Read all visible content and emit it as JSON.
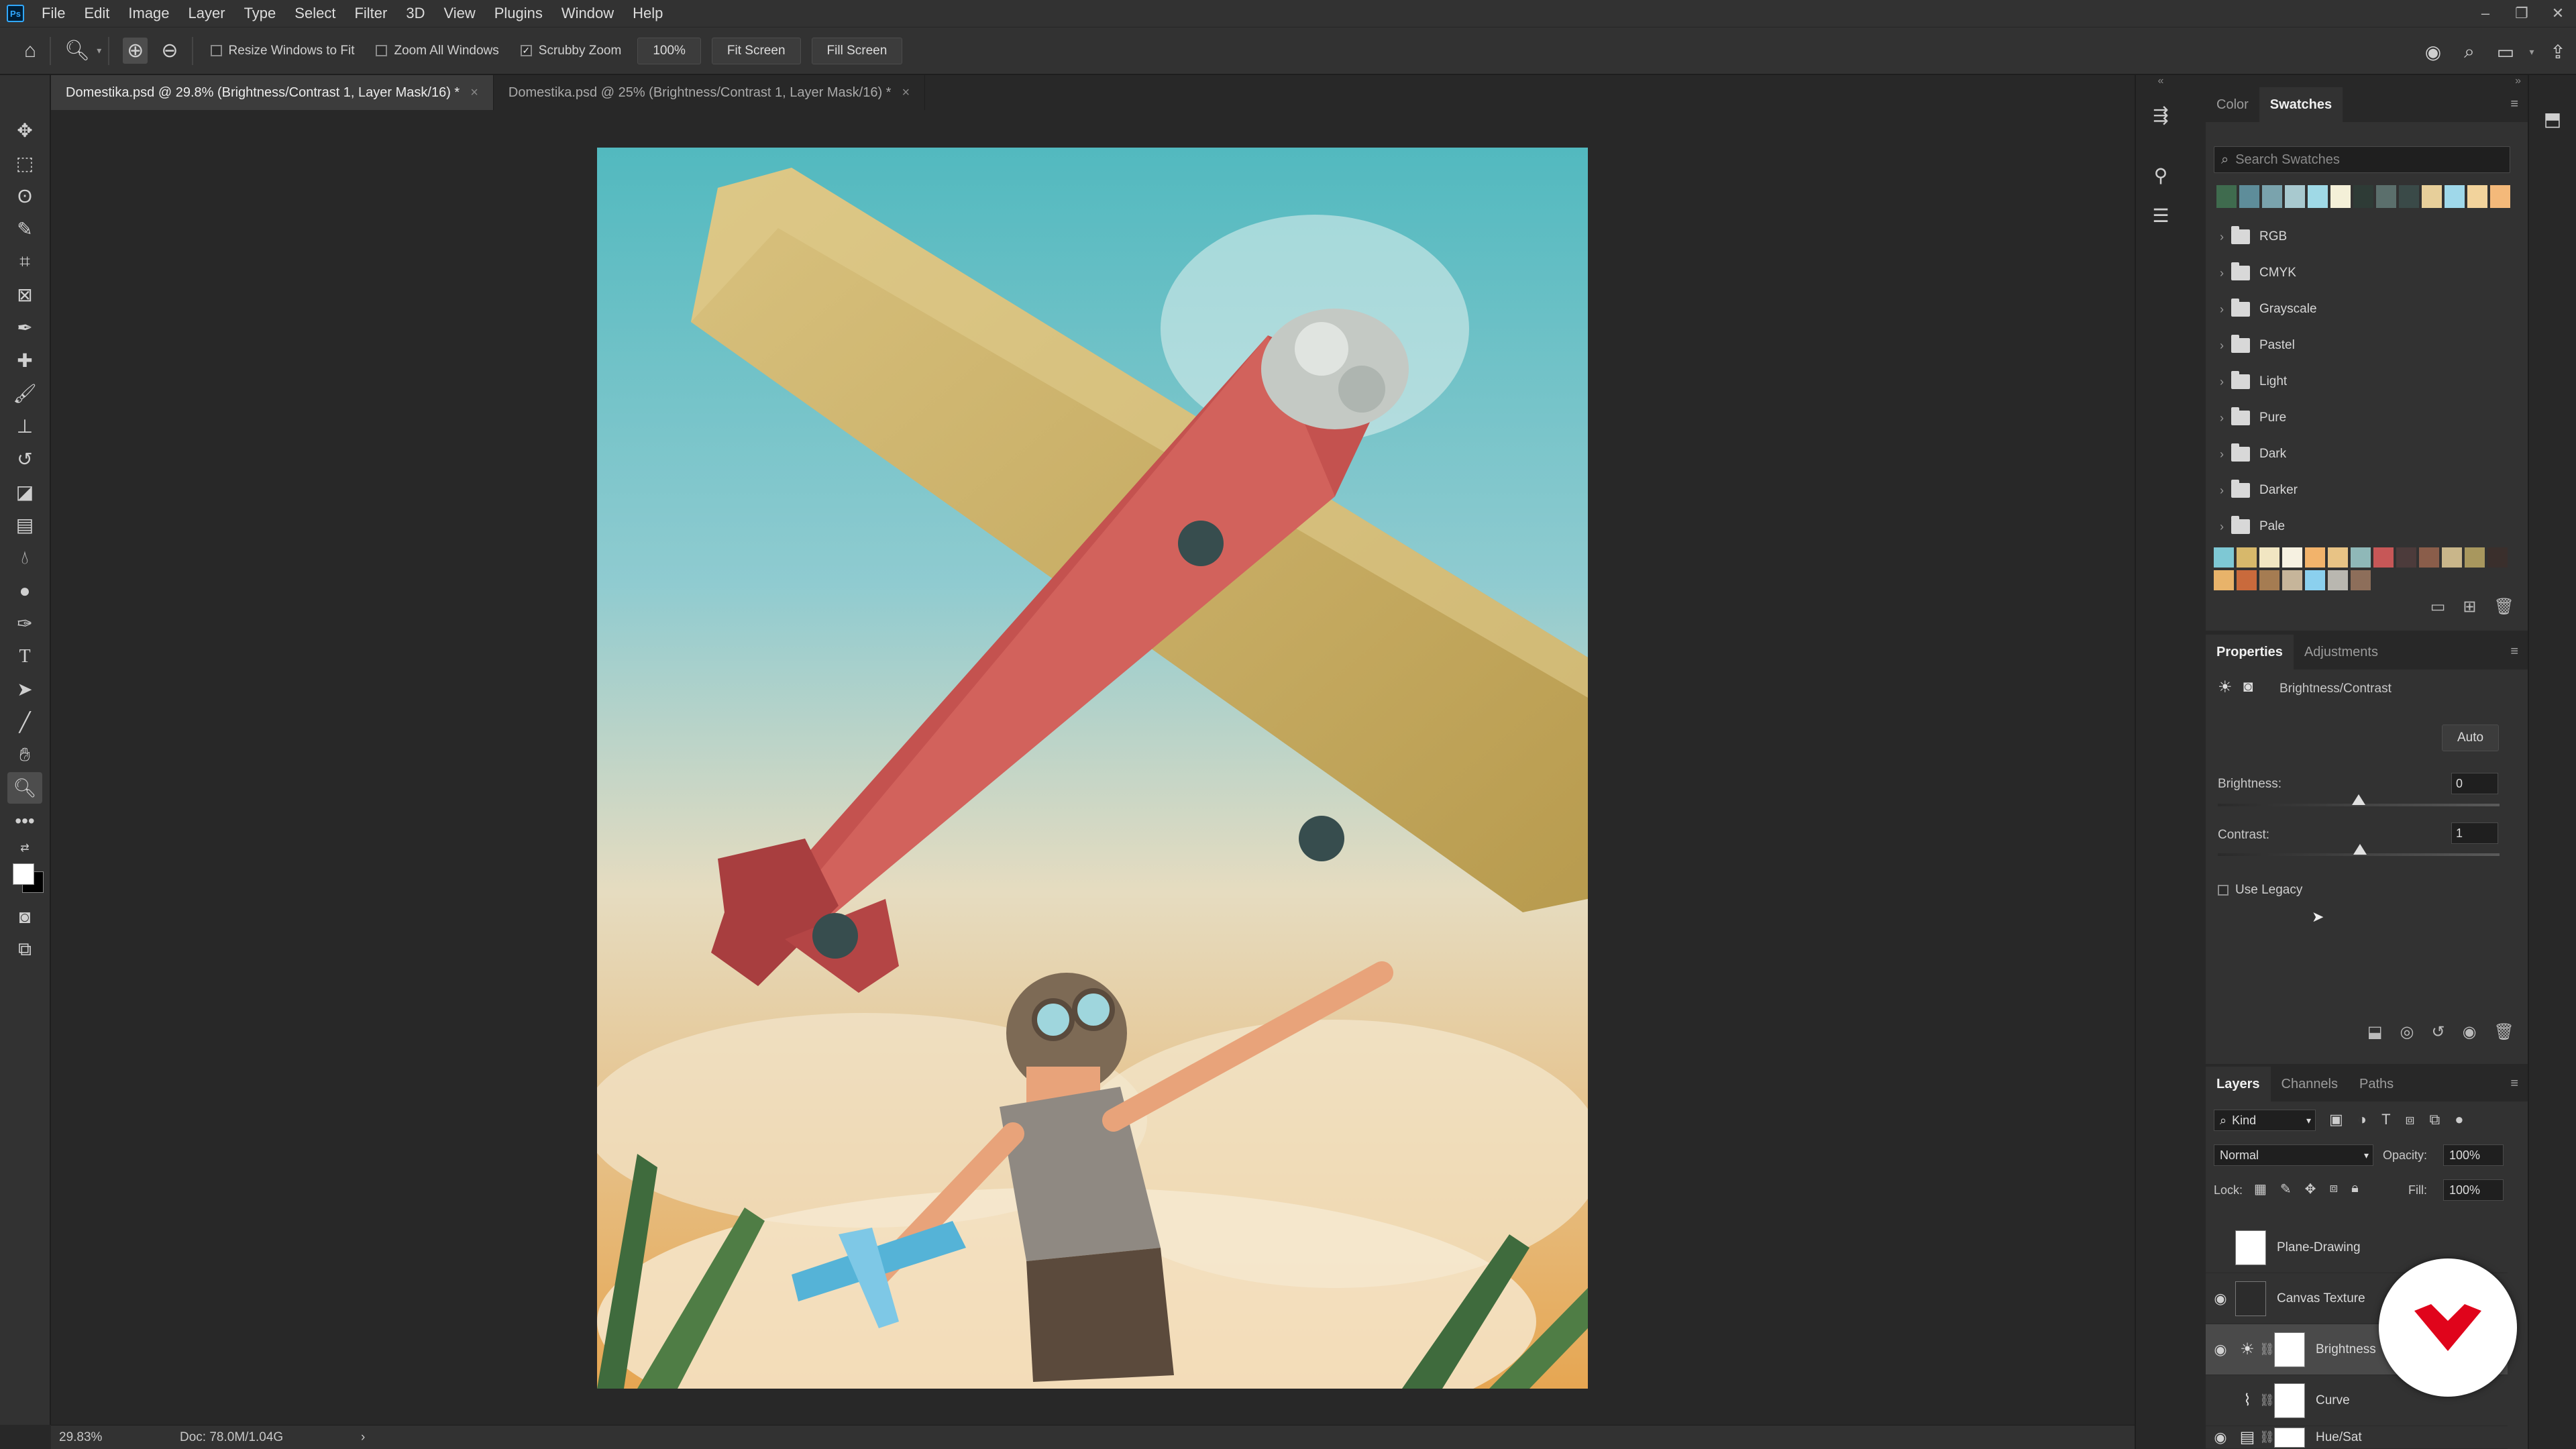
{
  "menubar": {
    "logo": "Ps",
    "items": [
      "File",
      "Edit",
      "Image",
      "Layer",
      "Type",
      "Select",
      "Filter",
      "3D",
      "View",
      "Plugins",
      "Window",
      "Help"
    ],
    "window_controls": [
      "minimize-icon",
      "restore-icon",
      "close-icon"
    ]
  },
  "options": {
    "resize_windows": "Resize Windows to Fit",
    "zoom_all": "Zoom All Windows",
    "scrubby_zoom": "Scrubby Zoom",
    "scrubby_checked": true,
    "zoom_value": "100%",
    "fit_screen": "Fit Screen",
    "fill_screen": "Fill Screen"
  },
  "tabs": [
    {
      "label": "Domestika.psd @ 29.8% (Brightness/Contrast 1, Layer Mask/16) *",
      "active": true
    },
    {
      "label": "Domestika.psd @ 25% (Brightness/Contrast 1, Layer Mask/16) *",
      "active": false
    }
  ],
  "status": {
    "zoom": "29.83%",
    "doc": "Doc: 78.0M/1.04G",
    "arrow": "›"
  },
  "swatches_panel": {
    "tabs": [
      "Color",
      "Swatches"
    ],
    "active_tab": "Swatches",
    "search_placeholder": "Search Swatches",
    "recent_colors": [
      "#3f6b4e",
      "#5e8d9a",
      "#7aa3ad",
      "#a8c9cf",
      "#9fd9e6",
      "#f4f0d8",
      "#2e3b36",
      "#5b6f6c",
      "#3a4a48",
      "#e7cf9a",
      "#9fd8ea",
      "#f2d39c",
      "#f4b97a"
    ],
    "groups": [
      "RGB",
      "CMYK",
      "Grayscale",
      "Pastel",
      "Light",
      "Pure",
      "Dark",
      "Darker",
      "Pale"
    ],
    "grid_colors": [
      "#7ec8d4",
      "#d7b86b",
      "#f1e6c2",
      "#f6f1e1",
      "#f2b36b",
      "#e8c385",
      "#8fb8b8",
      "#c75757",
      "#4c3b3b",
      "#8a5d4a",
      "#c9b68a",
      "#a8975e",
      "#3a2f2c",
      "#e8b36a",
      "#c96a3c",
      "#a57c52",
      "#c6b59a",
      "#8bd0ee",
      "#b9b7b0",
      "#8d6e5a"
    ]
  },
  "properties_panel": {
    "tabs": [
      "Properties",
      "Adjustments"
    ],
    "active_tab": "Properties",
    "adjustment_title": "Brightness/Contrast",
    "auto_label": "Auto",
    "brightness_label": "Brightness:",
    "brightness_value": "0",
    "contrast_label": "Contrast:",
    "contrast_value": "1",
    "use_legacy": "Use Legacy"
  },
  "layers_panel": {
    "tabs": [
      "Layers",
      "Channels",
      "Paths"
    ],
    "active_tab": "Layers",
    "filter_kind": "Kind",
    "blend_mode": "Normal",
    "opacity_label": "Opacity:",
    "opacity_value": "100%",
    "lock_label": "Lock:",
    "fill_label": "Fill:",
    "fill_value": "100%",
    "layers": [
      {
        "name": "Plane-Drawing",
        "visible": false,
        "type": "smart"
      },
      {
        "name": "Canvas Texture",
        "visible": true,
        "type": "smart"
      },
      {
        "name": "Brightness",
        "visible": true,
        "type": "brightness",
        "selected": true
      },
      {
        "name": "Curve",
        "visible": false,
        "type": "curves"
      },
      {
        "name": "Hue/Sat",
        "visible": true,
        "type": "huesat"
      }
    ]
  },
  "colors": {
    "accent_red": "#e0041b"
  }
}
